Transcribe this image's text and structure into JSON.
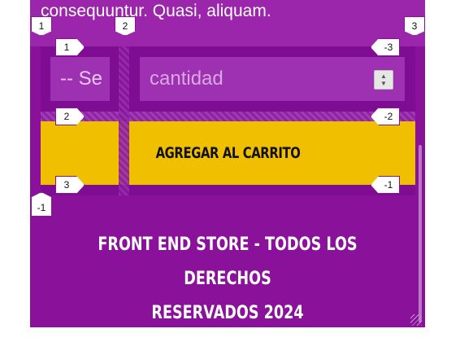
{
  "product": {
    "description_tail": "consequuntur. Quasi, aliquam."
  },
  "form": {
    "size_select_value": "-- Se",
    "quantity_placeholder": "cantidad",
    "add_to_cart_label": "AGREGAR AL CARRITO"
  },
  "footer": {
    "line1": "FRONT END STORE - TODOS LOS DERECHOS",
    "line2": "RESERVADOS 2024"
  },
  "grid_overlay": {
    "col_top": [
      "1",
      "2",
      "3"
    ],
    "col_bottom": [
      "-1"
    ],
    "row_left": [
      "1",
      "2",
      "3"
    ],
    "row_right": [
      "-3",
      "-2",
      "-1"
    ]
  },
  "colors": {
    "page_bg": "#8a119a",
    "button_bg": "#f0c000",
    "input_bg": "#9e31b1"
  }
}
